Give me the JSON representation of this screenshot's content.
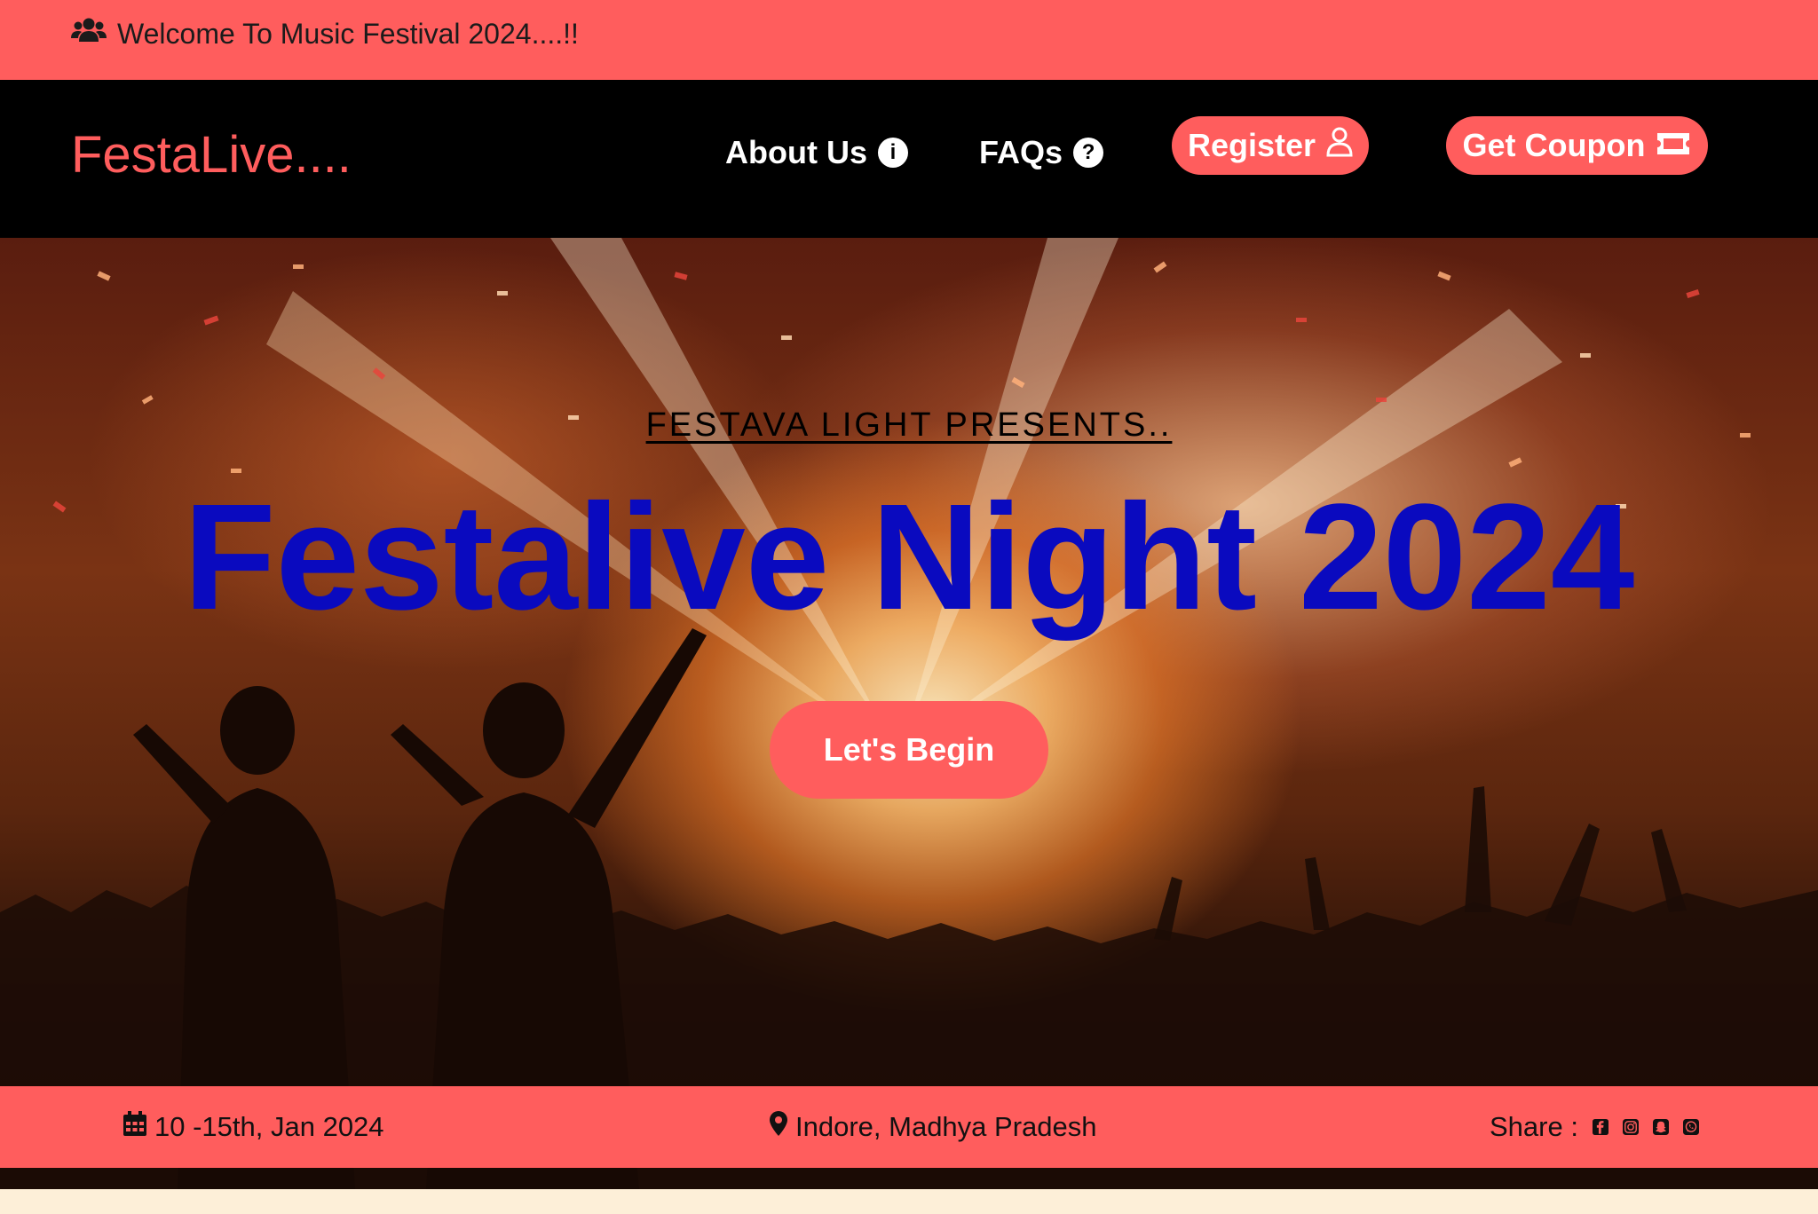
{
  "topbar": {
    "message": "Welcome To Music Festival 2024....!!",
    "icon": "users-icon"
  },
  "navbar": {
    "brand": "FestaLive....",
    "about_label": "About Us",
    "about_icon": "info-icon",
    "faq_label": "FAQs",
    "faq_icon": "question-icon",
    "register_label": "Register",
    "register_icon": "user-icon",
    "coupon_label": "Get Coupon",
    "coupon_icon": "ticket-icon"
  },
  "hero": {
    "presents": "FESTAVA LIGHT PRESENTS..",
    "title": "Festalive Night 2024",
    "cta_label": "Let's Begin"
  },
  "info": {
    "date": "10 -15th, Jan 2024",
    "location": "Indore, Madhya Pradesh",
    "share_label": "Share :",
    "share_icons": [
      "facebook-icon",
      "instagram-icon",
      "snapchat-icon",
      "whatsapp-icon"
    ]
  },
  "colors": {
    "accent": "#ff5d5d",
    "navbar_bg": "#000000",
    "hero_title": "#0a0abf",
    "page_bg": "#fdf0d9"
  }
}
